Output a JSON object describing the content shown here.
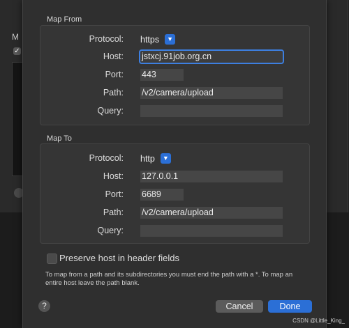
{
  "background_window": {
    "label_prefix": "M"
  },
  "map_from": {
    "title": "Map From",
    "protocol_label": "Protocol:",
    "protocol_value": "https",
    "host_label": "Host:",
    "host_value": "jstxcj.91job.org.cn",
    "port_label": "Port:",
    "port_value": "443",
    "path_label": "Path:",
    "path_value": "/v2/camera/upload",
    "query_label": "Query:",
    "query_value": ""
  },
  "map_to": {
    "title": "Map To",
    "protocol_label": "Protocol:",
    "protocol_value": "http",
    "host_label": "Host:",
    "host_value": "127.0.0.1",
    "port_label": "Port:",
    "port_value": "6689",
    "path_label": "Path:",
    "path_value": "/v2/camera/upload",
    "query_label": "Query:",
    "query_value": ""
  },
  "preserve_host": {
    "label": "Preserve host in header fields",
    "checked": false
  },
  "hint": "To map from a path and its subdirectories you must end the path with a *. To map an entire host leave the path blank.",
  "help_label": "?",
  "buttons": {
    "cancel": "Cancel",
    "done": "Done"
  },
  "watermark": "CSDN @Little_King_",
  "colors": {
    "accent": "#2b6fd6",
    "focus_ring": "#3d7fe0"
  }
}
